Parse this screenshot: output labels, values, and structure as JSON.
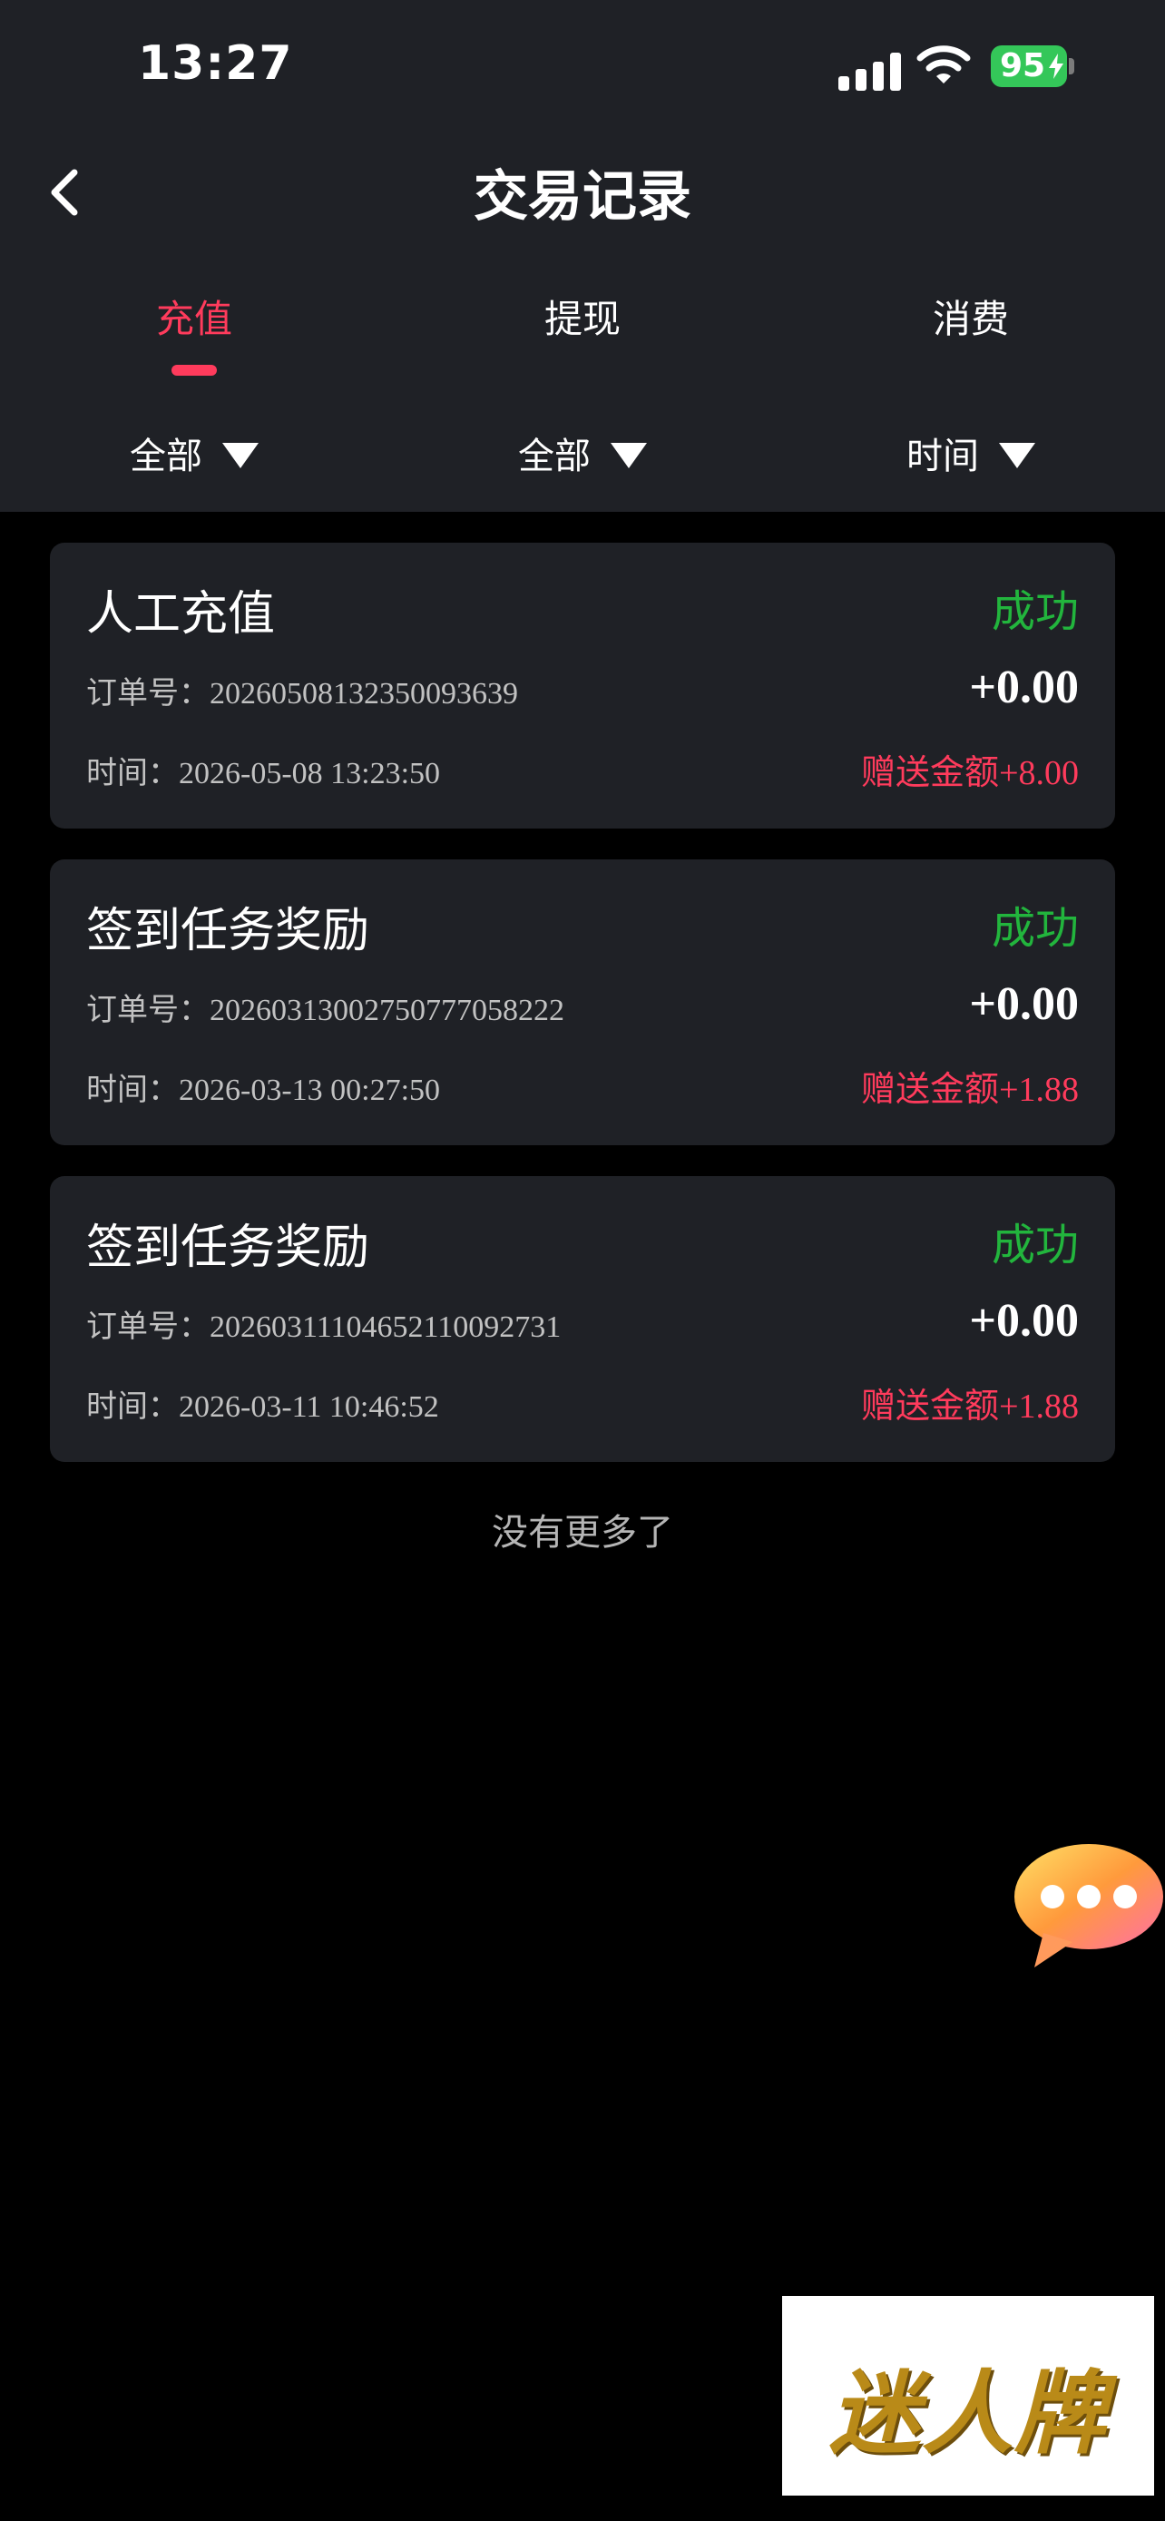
{
  "status_bar": {
    "time": "13:27",
    "battery": "95"
  },
  "header": {
    "title": "交易记录"
  },
  "tabs": [
    {
      "label": "充值"
    },
    {
      "label": "提现"
    },
    {
      "label": "消费"
    }
  ],
  "filters": [
    {
      "label": "全部"
    },
    {
      "label": "全部"
    },
    {
      "label": "时间"
    }
  ],
  "colors": {
    "accent": "#ff3b5c",
    "success": "#22b53d",
    "card_bg": "#1f2126",
    "page_bg": "#000000"
  },
  "records": [
    {
      "title": "人工充值",
      "status": "成功",
      "order_label": "订单号：",
      "order_no": "20260508132350093639",
      "amount": "+0.00",
      "time_label": "时间：",
      "time": "2026-05-08 13:23:50",
      "gift_label": "赠送金额",
      "gift_amount": "+8.00"
    },
    {
      "title": "签到任务奖励",
      "status": "成功",
      "order_label": "订单号：",
      "order_no": "20260313002750777058222",
      "amount": "+0.00",
      "time_label": "时间：",
      "time": "2026-03-13 00:27:50",
      "gift_label": "赠送金额",
      "gift_amount": "+1.88"
    },
    {
      "title": "签到任务奖励",
      "status": "成功",
      "order_label": "订单号：",
      "order_no": "20260311104652110092731",
      "amount": "+0.00",
      "time_label": "时间：",
      "time": "2026-03-11 10:46:52",
      "gift_label": "赠送金额",
      "gift_amount": "+1.88"
    }
  ],
  "footer": {
    "no_more": "没有更多了"
  },
  "brand": {
    "logo_text": "迷人牌"
  },
  "icons": {
    "back": "chevron-left-icon",
    "chat": "chat-bubble-icon",
    "filter": "triangle-down-icon"
  }
}
